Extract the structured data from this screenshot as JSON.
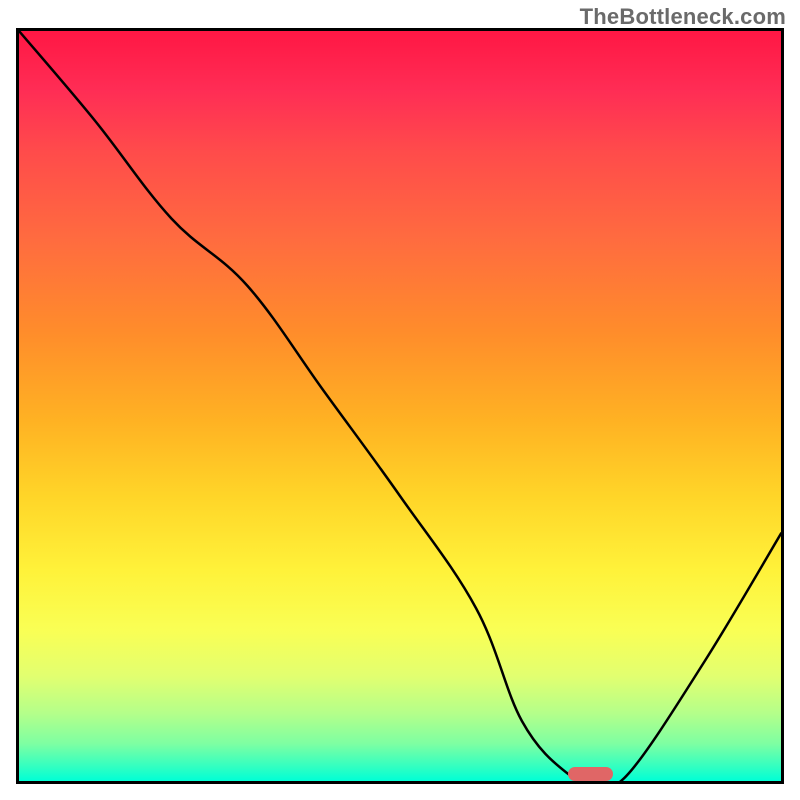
{
  "watermark": "TheBottleneck.com",
  "chart_data": {
    "type": "line",
    "title": "",
    "xlabel": "",
    "ylabel": "",
    "xlim": [
      0,
      100
    ],
    "ylim": [
      0,
      100
    ],
    "x": [
      0,
      10,
      20,
      30,
      40,
      50,
      60,
      66,
      72,
      76,
      80,
      90,
      100
    ],
    "values": [
      100,
      88,
      75,
      66,
      52,
      38,
      23,
      8,
      1,
      0,
      1,
      16,
      33
    ],
    "marker": {
      "x_start": 72,
      "x_end": 78,
      "y": 0
    }
  }
}
